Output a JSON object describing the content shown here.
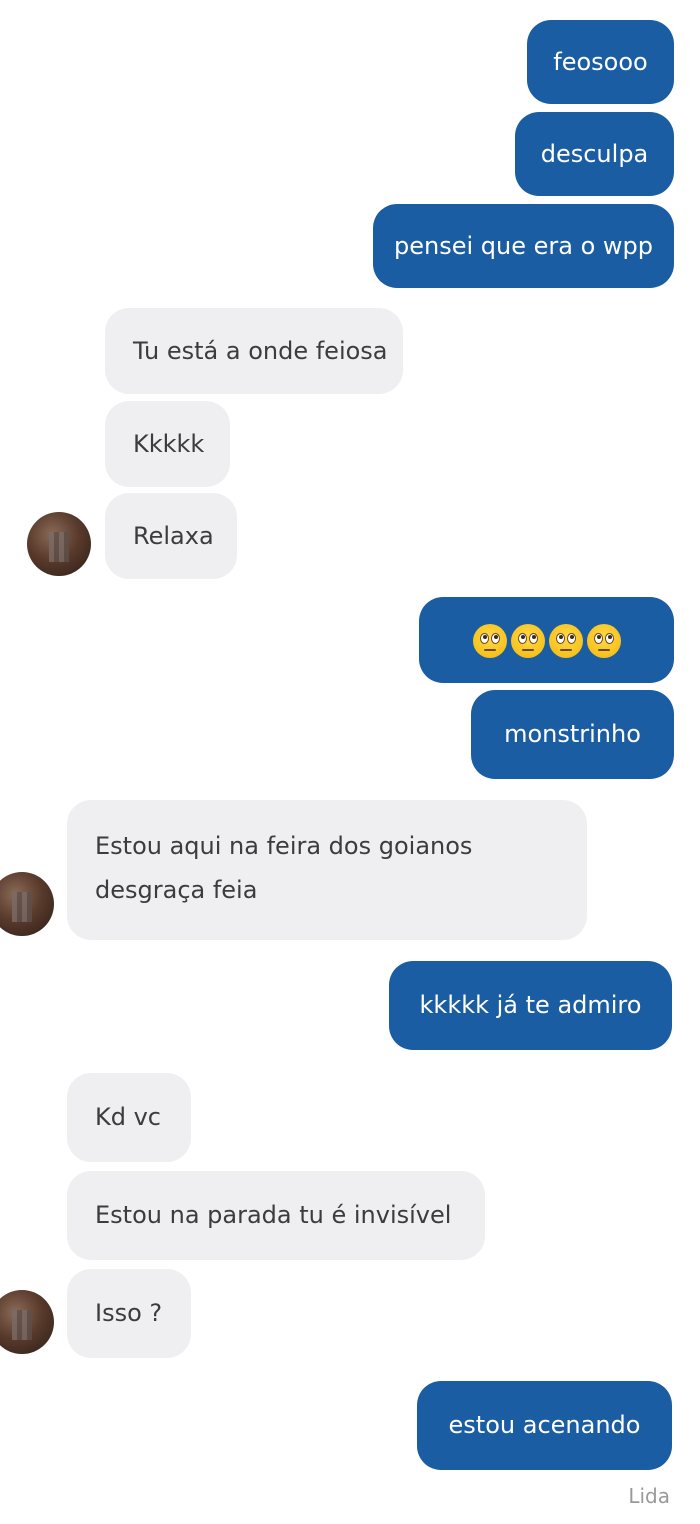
{
  "messages": [
    {
      "id": "m1",
      "dir": "out",
      "text": "feosooo"
    },
    {
      "id": "m2",
      "dir": "out",
      "text": "desculpa"
    },
    {
      "id": "m3",
      "dir": "out",
      "text": "pensei que era o wpp"
    },
    {
      "id": "m4",
      "dir": "in",
      "text": "Tu está a onde feiosa"
    },
    {
      "id": "m5",
      "dir": "in",
      "text": "Kkkkk"
    },
    {
      "id": "m6",
      "dir": "in",
      "text": "Relaxa"
    },
    {
      "id": "m7",
      "dir": "out",
      "text": "",
      "emoji": [
        "rolling-eyes-emoji",
        "rolling-eyes-emoji",
        "rolling-eyes-emoji",
        "rolling-eyes-emoji"
      ]
    },
    {
      "id": "m8",
      "dir": "out",
      "text": "monstrinho"
    },
    {
      "id": "m9",
      "dir": "in",
      "text": "Estou aqui na feira dos goianos desgraça feia"
    },
    {
      "id": "m10",
      "dir": "out",
      "text": "kkkkk já te admiro"
    },
    {
      "id": "m11",
      "dir": "in",
      "text": "Kd vc"
    },
    {
      "id": "m12",
      "dir": "in",
      "text": "Estou na parada tu é invisível"
    },
    {
      "id": "m13",
      "dir": "in",
      "text": "Isso ?"
    },
    {
      "id": "m14",
      "dir": "out",
      "text": "estou acenando"
    }
  ],
  "read_status": "Lida",
  "colors": {
    "outgoing_bubble": "#1b5da3",
    "incoming_bubble": "#efeff1",
    "outgoing_text": "#ffffff",
    "incoming_text": "#3c3c3c"
  }
}
